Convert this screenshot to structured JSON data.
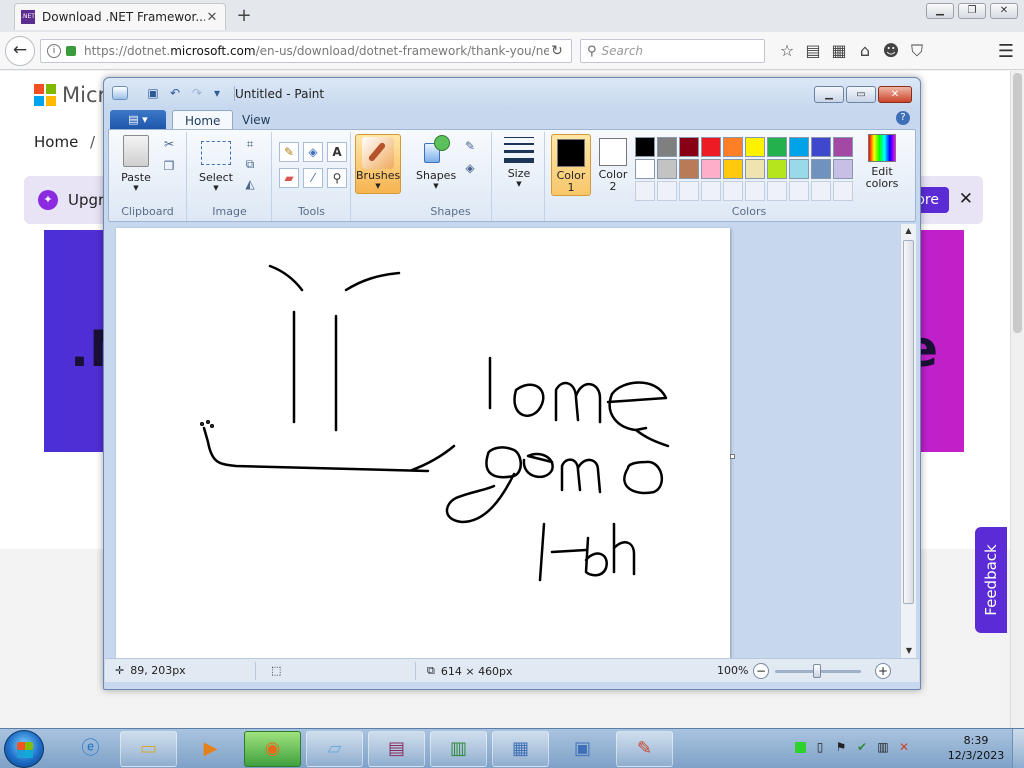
{
  "browser": {
    "tab_title": "Download .NET Framewor...",
    "tab_favicon": ".NET",
    "url_prefix": "https://dotnet.",
    "url_domain": "microsoft.com",
    "url_path": "/en-us/download/dotnet-framework/thank-you/ne",
    "search_placeholder": "Search",
    "icons": [
      "back-arrow-icon",
      "info-icon",
      "lock-icon",
      "reload-icon",
      "search-icon",
      "star-icon",
      "reading-list-icon",
      "addon-icon",
      "home-icon",
      "smiley-icon",
      "pocket-icon",
      "menu-icon"
    ]
  },
  "webpage": {
    "brand": "Micr",
    "crumb_home": "Home",
    "crumb_sep": "/",
    "upgrade_text": "Upgr",
    "more_button": "ore",
    "upgrade_close": "✕",
    "hero_left": ".N",
    "hero_right": "e",
    "feedback": "Feedback",
    "logo_colors": [
      "#f25022",
      "#7fba00",
      "#00a4ef",
      "#ffb900"
    ]
  },
  "paint": {
    "title": "Untitled - Paint",
    "tabs": [
      {
        "label": "Home",
        "active": true
      },
      {
        "label": "View",
        "active": false
      }
    ],
    "groups": {
      "clipboard": {
        "label": "Clipboard",
        "paste": "Paste"
      },
      "image": {
        "label": "Image",
        "select": "Select"
      },
      "tools": {
        "label": "Tools"
      },
      "brushes": {
        "label": "Brushes"
      },
      "shapes": {
        "label": "Shapes",
        "shapes_btn": "Shapes"
      },
      "size": {
        "label": "Size"
      },
      "colors": {
        "label": "Colors",
        "color1_a": "Color",
        "color1_b": "1",
        "color2_a": "Color",
        "color2_b": "2",
        "edit_a": "Edit",
        "edit_b": "colors"
      }
    },
    "color1": "#000000",
    "color2": "#ffffff",
    "palette": [
      "#000000",
      "#7f7f7f",
      "#880015",
      "#ed1c24",
      "#ff7f27",
      "#fff200",
      "#22b14c",
      "#00a2e8",
      "#3f48cc",
      "#a349a4",
      "#ffffff",
      "#c3c3c3",
      "#b97a57",
      "#ffaec9",
      "#ffc90e",
      "#efe4b0",
      "#b5e61d",
      "#99d9ea",
      "#7092be",
      "#c8bfe7"
    ],
    "palette_empty_count": 10,
    "status": {
      "cursor_pos": "89, 203px",
      "image_size": "614 × 460px",
      "zoom": "100%"
    }
  },
  "taskbar": {
    "time": "8:39",
    "date": "12/3/2023",
    "items": [
      "ie-icon",
      "explorer-icon",
      "media-player-icon",
      "firefox-icon",
      "notepad-icon",
      "winrar-icon",
      "task-manager-icon",
      "control-panel-icon",
      "remote-desktop-icon",
      "paint-icon"
    ]
  }
}
